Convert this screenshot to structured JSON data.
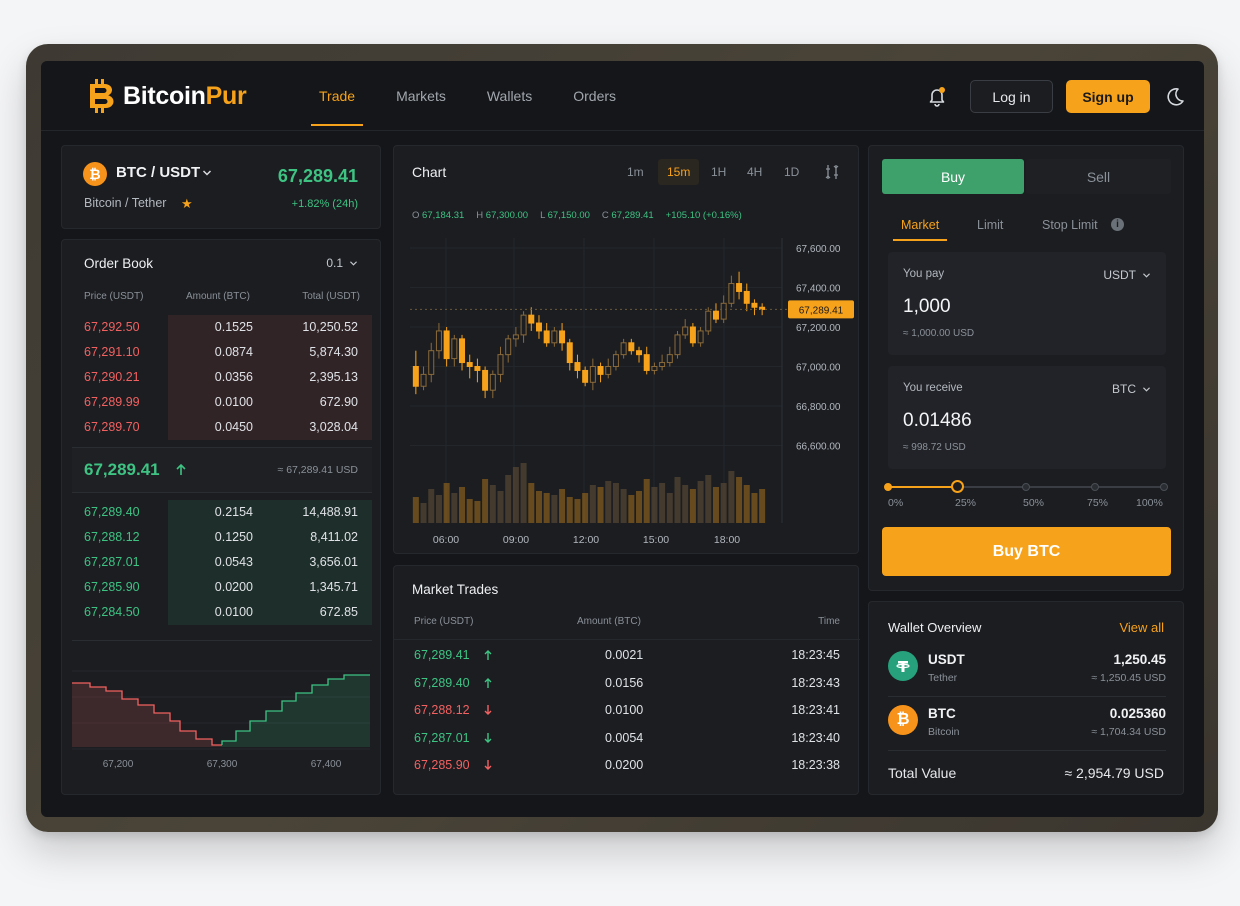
{
  "brand": {
    "name_a": "Bitcoin",
    "name_b": "Pur"
  },
  "nav": [
    {
      "label": "Trade",
      "active": true
    },
    {
      "label": "Markets"
    },
    {
      "label": "Wallets"
    },
    {
      "label": "Orders"
    }
  ],
  "header": {
    "login": "Log in",
    "signup": "Sign up"
  },
  "pair": {
    "symbol": "BTC / USDT",
    "name": "Bitcoin / Tether",
    "price": "67,289.41",
    "change": "+1.82% (24h)"
  },
  "order_book": {
    "title": "Order Book",
    "precision": "0.1",
    "headers": {
      "price": "Price (USDT)",
      "amount": "Amount (BTC)",
      "total": "Total (USDT)"
    },
    "asks": [
      {
        "price": "67,292.50",
        "amount": "0.1525",
        "total": "10,250.52",
        "depth": 0.68
      },
      {
        "price": "67,291.10",
        "amount": "0.0874",
        "total": "5,874.30",
        "depth": 0.68
      },
      {
        "price": "67,290.21",
        "amount": "0.0356",
        "total": "2,395.13",
        "depth": 0.68
      },
      {
        "price": "67,289.99",
        "amount": "0.0100",
        "total": "672.90",
        "depth": 0.68
      },
      {
        "price": "67,289.70",
        "amount": "0.0450",
        "total": "3,028.04",
        "depth": 0.68
      }
    ],
    "last_price": "67,289.41",
    "last_price_usd": "≈ 67,289.41 USD",
    "bids": [
      {
        "price": "67,289.40",
        "amount": "0.2154",
        "total": "14,488.91",
        "depth": 0.68
      },
      {
        "price": "67,288.12",
        "amount": "0.1250",
        "total": "8,411.02",
        "depth": 0.68
      },
      {
        "price": "67,287.01",
        "amount": "0.0543",
        "total": "3,656.01",
        "depth": 0.68
      },
      {
        "price": "67,285.90",
        "amount": "0.0200",
        "total": "1,345.71",
        "depth": 0.68
      },
      {
        "price": "67,284.50",
        "amount": "0.0100",
        "total": "672.85",
        "depth": 0.68
      }
    ],
    "depth_axis": [
      "67,200",
      "67,300",
      "67,400"
    ]
  },
  "chart": {
    "title": "Chart",
    "timeframes": [
      "1m",
      "15m",
      "1H",
      "4H",
      "1D"
    ],
    "active_timeframe": "15m",
    "ohlc": {
      "o": "67,184.31",
      "h": "67,300.00",
      "l": "67,150.00",
      "c": "67,289.41",
      "chg": "+105.10 (+0.16%)"
    },
    "current_price_tag": "67,289.41",
    "colors": {
      "up": "#3ec383",
      "down": "#f26161",
      "candle": "#f7a21b"
    }
  },
  "chart_data": {
    "type": "candlestick",
    "x_ticks": [
      "06:00",
      "09:00",
      "12:00",
      "15:00",
      "18:00"
    ],
    "y_ticks": [
      "67,600.00",
      "67,400.00",
      "67,200.00",
      "67,000.00",
      "66,800.00",
      "66,600.00"
    ],
    "ylim": [
      66600,
      67600
    ],
    "last": 67289.41,
    "candles": [
      [
        67000,
        66900,
        67080,
        66860
      ],
      [
        66900,
        66960,
        67000,
        66880
      ],
      [
        66960,
        67080,
        67120,
        66920
      ],
      [
        67080,
        67180,
        67220,
        67040
      ],
      [
        67180,
        67040,
        67200,
        67000
      ],
      [
        67040,
        67140,
        67160,
        67000
      ],
      [
        67140,
        67020,
        67160,
        66980
      ],
      [
        67020,
        67000,
        67060,
        66940
      ],
      [
        67000,
        66980,
        67040,
        66920
      ],
      [
        66980,
        66880,
        67000,
        66840
      ],
      [
        66880,
        66960,
        66980,
        66840
      ],
      [
        66960,
        67060,
        67100,
        66920
      ],
      [
        67060,
        67140,
        67160,
        67020
      ],
      [
        67140,
        67160,
        67200,
        67100
      ],
      [
        67160,
        67260,
        67280,
        67120
      ],
      [
        67260,
        67220,
        67300,
        67180
      ],
      [
        67220,
        67180,
        67260,
        67140
      ],
      [
        67180,
        67120,
        67220,
        67100
      ],
      [
        67120,
        67180,
        67200,
        67100
      ],
      [
        67180,
        67120,
        67220,
        67080
      ],
      [
        67120,
        67020,
        67140,
        66980
      ],
      [
        67020,
        66980,
        67060,
        66940
      ],
      [
        66980,
        66920,
        67000,
        66900
      ],
      [
        66920,
        67000,
        67040,
        66880
      ],
      [
        67000,
        66960,
        67020,
        66920
      ],
      [
        66960,
        67000,
        67040,
        66940
      ],
      [
        67000,
        67060,
        67080,
        66980
      ],
      [
        67060,
        67120,
        67140,
        67040
      ],
      [
        67120,
        67080,
        67140,
        67060
      ],
      [
        67080,
        67060,
        67100,
        67020
      ],
      [
        67060,
        66980,
        67100,
        66960
      ],
      [
        66980,
        67000,
        67020,
        66960
      ],
      [
        67000,
        67020,
        67060,
        66980
      ],
      [
        67020,
        67060,
        67100,
        67000
      ],
      [
        67060,
        67160,
        67180,
        67040
      ],
      [
        67160,
        67200,
        67240,
        67140
      ],
      [
        67200,
        67120,
        67220,
        67100
      ],
      [
        67120,
        67180,
        67200,
        67100
      ],
      [
        67180,
        67280,
        67300,
        67160
      ],
      [
        67280,
        67240,
        67320,
        67220
      ],
      [
        67240,
        67320,
        67360,
        67220
      ],
      [
        67320,
        67420,
        67460,
        67300
      ],
      [
        67420,
        67380,
        67480,
        67340
      ],
      [
        67380,
        67320,
        67420,
        67280
      ],
      [
        67320,
        67300,
        67340,
        67260
      ],
      [
        67300,
        67289,
        67320,
        67260
      ]
    ]
  },
  "market_trades": {
    "title": "Market Trades",
    "headers": {
      "price": "Price (USDT)",
      "amount": "Amount (BTC)",
      "time": "Time"
    },
    "rows": [
      {
        "price": "67,289.41",
        "side": "up",
        "amount": "0.0021",
        "time": "18:23:45"
      },
      {
        "price": "67,289.40",
        "side": "up",
        "amount": "0.0156",
        "time": "18:23:43"
      },
      {
        "price": "67,288.12",
        "side": "down",
        "amount": "0.0100",
        "time": "18:23:41"
      },
      {
        "price": "67,287.01",
        "side": "up-down",
        "amount": "0.0054",
        "time": "18:23:40"
      },
      {
        "price": "67,285.90",
        "side": "down",
        "amount": "0.0200",
        "time": "18:23:38"
      }
    ]
  },
  "trade": {
    "buy_tab": "Buy",
    "sell_tab": "Sell",
    "order_types": [
      "Market",
      "Limit",
      "Stop Limit"
    ],
    "pay": {
      "label": "You pay",
      "currency": "USDT",
      "value": "1,000",
      "usd": "≈ 1,000.00 USD"
    },
    "receive": {
      "label": "You receive",
      "currency": "BTC",
      "value": "0.01486",
      "usd": "≈ 998.72 USD"
    },
    "slider_marks": [
      "0%",
      "25%",
      "50%",
      "75%",
      "100%"
    ],
    "slider_value": 0.25,
    "buy_button": "Buy BTC"
  },
  "wallet": {
    "title": "Wallet Overview",
    "view_all": "View all",
    "items": [
      {
        "symbol": "USDT",
        "name": "Tether",
        "amount": "1,250.45",
        "usd": "≈ 1,250.45 USD",
        "color": "#26a17b"
      },
      {
        "symbol": "BTC",
        "name": "Bitcoin",
        "amount": "0.025360",
        "usd": "≈ 1,704.34 USD",
        "color": "#f7931a"
      }
    ],
    "total_label": "Total Value",
    "total_value": "≈ 2,954.79 USD"
  }
}
